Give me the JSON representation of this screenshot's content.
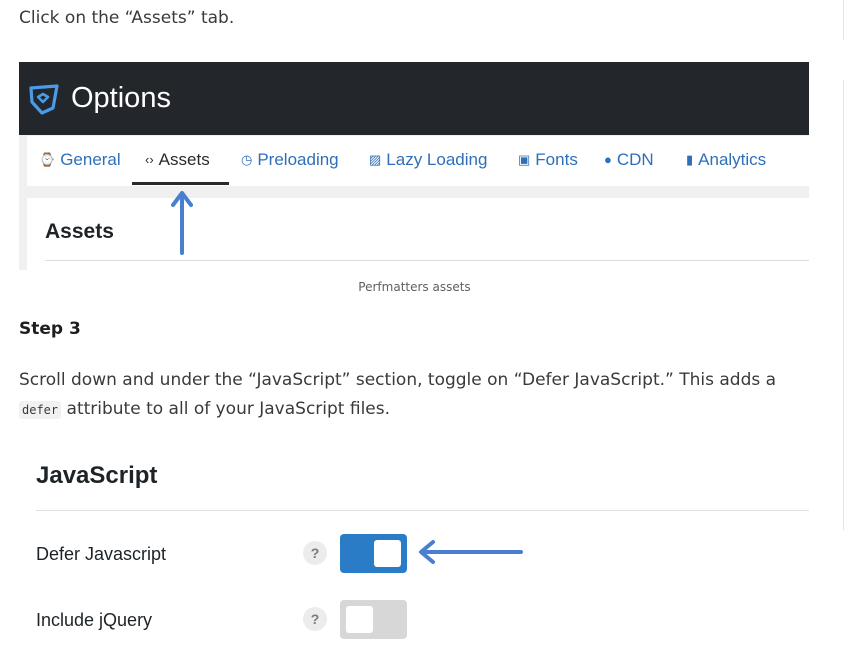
{
  "intro_text": "Click on the “Assets” tab.",
  "screenshot1": {
    "app_title": "Options",
    "tabs": [
      {
        "label": "General",
        "icon": "dashboard-icon",
        "glyph": "⌚",
        "active": false
      },
      {
        "label": "Assets",
        "icon": "code-icon",
        "glyph": "‹›",
        "active": true
      },
      {
        "label": "Preloading",
        "icon": "clock-icon",
        "glyph": "◷",
        "active": false
      },
      {
        "label": "Lazy Loading",
        "icon": "image-icon",
        "glyph": "▨",
        "active": false
      },
      {
        "label": "Fonts",
        "icon": "gift-icon",
        "glyph": "▣",
        "active": false
      },
      {
        "label": "CDN",
        "icon": "globe-icon",
        "glyph": "●",
        "active": false
      },
      {
        "label": "Analytics",
        "icon": "bar-chart-icon",
        "glyph": "▮",
        "active": false
      }
    ],
    "panel_title": "Assets",
    "arrow_color": "#4a7fd0"
  },
  "caption": "Perfmatters assets",
  "step_heading": "Step 3",
  "paragraph": {
    "before": "Scroll down and under the “JavaScript” section, toggle on “Defer JavaScript.” This adds a ",
    "code": "defer",
    "after": " attribute to all of your JavaScript files."
  },
  "screenshot2": {
    "section_title": "JavaScript",
    "options": [
      {
        "label": "Defer Javascript",
        "help": "?",
        "state": "on"
      },
      {
        "label": "Include jQuery",
        "help": "?",
        "state": "off"
      }
    ],
    "toggle_on_color": "#2a7cc7",
    "arrow_color": "#4a7fd0"
  }
}
